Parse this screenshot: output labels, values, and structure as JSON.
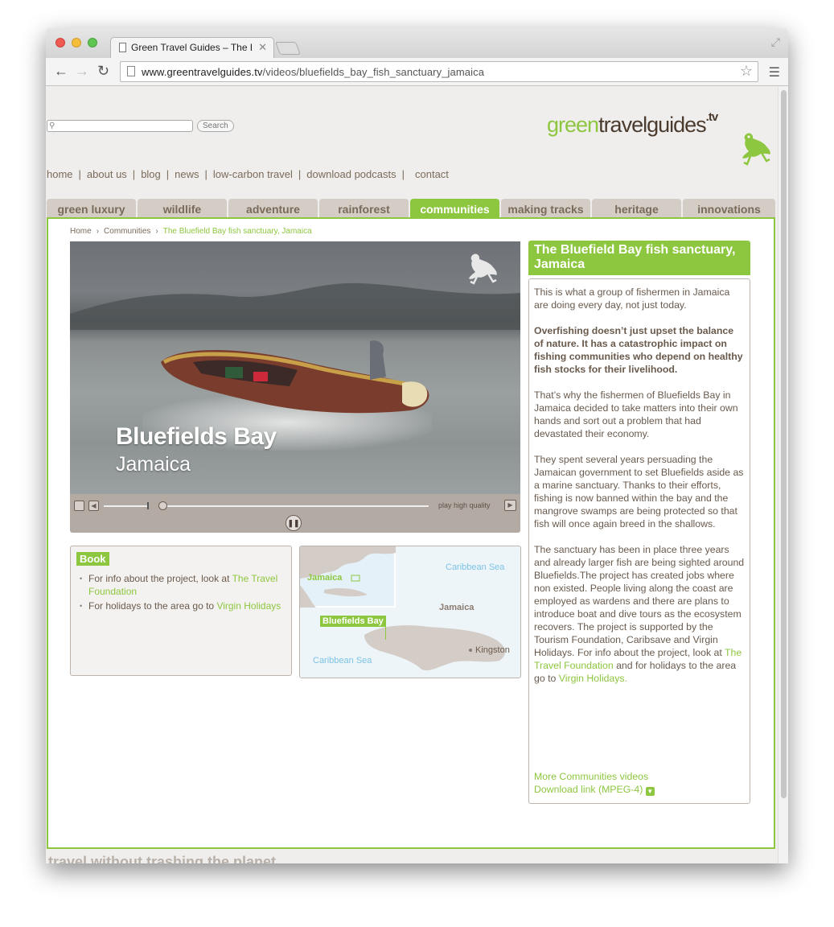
{
  "browser": {
    "tab_title": "Green Travel Guides – The Bl",
    "tab_close": "✕",
    "url_domain": "www.greentravelguides.tv",
    "url_path": "/videos/bluefields_bay_fish_sanctuary_jamaica"
  },
  "header": {
    "search_placeholder": "",
    "search_button": "Search",
    "logo_part1": "green",
    "logo_part2": "travel",
    "logo_part3": "guides",
    "logo_part4": ".tv"
  },
  "topnav": [
    "home",
    "about us",
    "blog",
    "news",
    "low-carbon travel",
    "download podcasts",
    "contact"
  ],
  "category_tabs": [
    "green luxury",
    "wildlife",
    "adventure",
    "rainforest",
    "communities",
    "making tracks",
    "heritage",
    "innovations"
  ],
  "active_tab": "communities",
  "breadcrumb": {
    "home": "Home",
    "section": "Communities",
    "current": "The Bluefield Bay fish sanctuary, Jamaica",
    "separator": "›"
  },
  "video": {
    "title": "Bluefields Bay",
    "subtitle": "Jamaica",
    "play_hq": "play high quality"
  },
  "book": {
    "heading": "Book",
    "item1_text": "For info about the project, look at ",
    "item1_link": "The Travel Foundation",
    "item2_text": "For holidays to the area go to ",
    "item2_link": "Virgin Holidays"
  },
  "map": {
    "inset_label": "Jamaica",
    "sea_top": "Caribbean Sea",
    "island_label": "Jamaica",
    "marker_label": "Bluefields Bay",
    "city_label": "Kingston",
    "sea_bottom": "Caribbean Sea"
  },
  "article": {
    "title": "The Bluefield Bay fish sanctuary, Jamaica",
    "p1": "This is what a group of fishermen in Jamaica are doing every day, not just today.",
    "p2": "Overfishing doesn’t just upset the balance of nature. It has a catastrophic impact on fishing communities who depend on healthy fish stocks for their livelihood.",
    "p3": "That’s why the fishermen of Bluefields Bay in Jamaica decided to take matters into their own hands and sort out a problem that had devastated their economy.",
    "p4": "They spent several years persuading the Jamaican government to set Bluefields aside as a marine sanctuary. Thanks to their efforts, fishing is now banned within the bay and the mangrove swamps are being protected so that fish will once again breed in the shallows.",
    "p5_text": "The sanctuary has been in place three years and already larger fish are being sighted around Bluefields.The project has created jobs where non existed. People living along the coast are employed as wardens and there are plans to introduce boat and dive tours as the ecosystem recovers. The project is supported by the Tourism Foundation, Caribsave and Virgin Holidays. For info about the project, look at ",
    "p5_link1": "The Travel Foundation",
    "p5_mid": " and for holidays to the area go to ",
    "p5_link2": "Virgin Holidays.",
    "more_videos": "More Communities videos",
    "download": "Download link (MPEG-4)"
  },
  "footer": {
    "tagline": "travel without trashing the planet"
  },
  "colors": {
    "accent_green": "#8dc63f",
    "brown_text": "#6a5a4c",
    "tab_inactive": "#d3cdc6"
  }
}
